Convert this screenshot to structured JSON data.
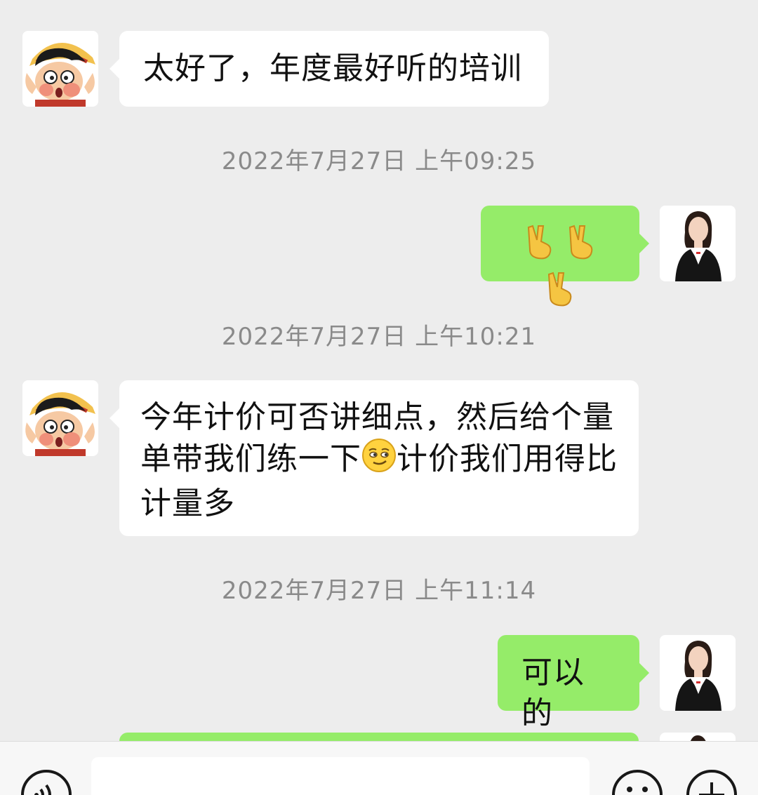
{
  "messages": [
    {
      "side": "incoming",
      "avatar": "cartoon-straw-hat-avatar",
      "text": "太好了，年度最好听的培训"
    },
    {
      "timestamp": "2022年7月27日 上午09:25"
    },
    {
      "side": "outgoing",
      "avatar": "woman-suit-avatar",
      "emoji": [
        "victory-hand-emoji",
        "victory-hand-emoji",
        "victory-hand-emoji"
      ]
    },
    {
      "timestamp": "2022年7月27日 上午10:21"
    },
    {
      "side": "incoming",
      "avatar": "cartoon-straw-hat-avatar",
      "line1": "今年计价可否讲细点，然后给个量",
      "line2_before": "单带我们练一下",
      "line2_emoji": "smirk-face-emoji",
      "line2_after": "计价我们用得比",
      "line3": "计量多"
    },
    {
      "timestamp": "2022年7月27日 上午11:14"
    },
    {
      "side": "outgoing",
      "avatar": "woman-suit-avatar",
      "text": "可以的"
    }
  ],
  "input_bar": {
    "left_icon": "voice-icon",
    "right_icons": [
      "emoji-icon",
      "plus-icon"
    ]
  },
  "colors": {
    "background": "#ededed",
    "incoming_bubble": "#ffffff",
    "outgoing_bubble": "#95ec69",
    "timestamp": "#8a8a8a"
  }
}
